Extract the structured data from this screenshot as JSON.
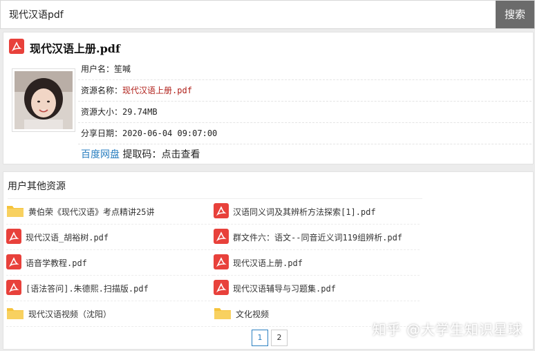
{
  "search": {
    "value": "现代汉语pdf",
    "button_label": "搜索"
  },
  "resource": {
    "title": "现代汉语上册.pdf",
    "icon": "pdf-icon",
    "fields": [
      {
        "label": "用户名：",
        "value": "笙喊"
      },
      {
        "label": "资源名称：",
        "value": "现代汉语上册.pdf"
      },
      {
        "label": "资源大小：",
        "value": "29.74MB"
      },
      {
        "label": "分享日期：",
        "value": "2020-06-04 09:07:00"
      }
    ],
    "pan_link": "百度网盘",
    "code_label": "提取码：",
    "code_link": "点击查看"
  },
  "others": {
    "heading": "用户其他资源",
    "items": [
      {
        "name": "黄伯荣《现代汉语》考点精讲25讲",
        "icon": "folder-icon"
      },
      {
        "name": "汉语同义词及其辨析方法探索[1].pdf",
        "icon": "pdf-icon"
      },
      {
        "name": "现代汉语_胡裕树.pdf",
        "icon": "pdf-icon"
      },
      {
        "name": "群文件六：语文--同音近义词119组辨析.pdf",
        "icon": "pdf-icon"
      },
      {
        "name": "语音学教程.pdf",
        "icon": "pdf-icon"
      },
      {
        "name": "现代汉语上册.pdf",
        "icon": "pdf-icon"
      },
      {
        "name": "[语法答问].朱德熙.扫描版.pdf",
        "icon": "pdf-icon"
      },
      {
        "name": "现代汉语辅导与习题集.pdf",
        "icon": "pdf-icon"
      },
      {
        "name": "现代汉语视频（沈阳）",
        "icon": "folder-icon"
      },
      {
        "name": "文化视频",
        "icon": "folder-icon"
      }
    ],
    "pages": [
      "1",
      "2"
    ]
  },
  "watermark": "知乎 @大学生知识星球",
  "colors": {
    "pdf_red": "#e8413b",
    "folder_yellow": "#f5c33b",
    "link_red": "#b0201a",
    "link_blue": "#2a7fc0",
    "search_button": "#6b6b6b"
  }
}
